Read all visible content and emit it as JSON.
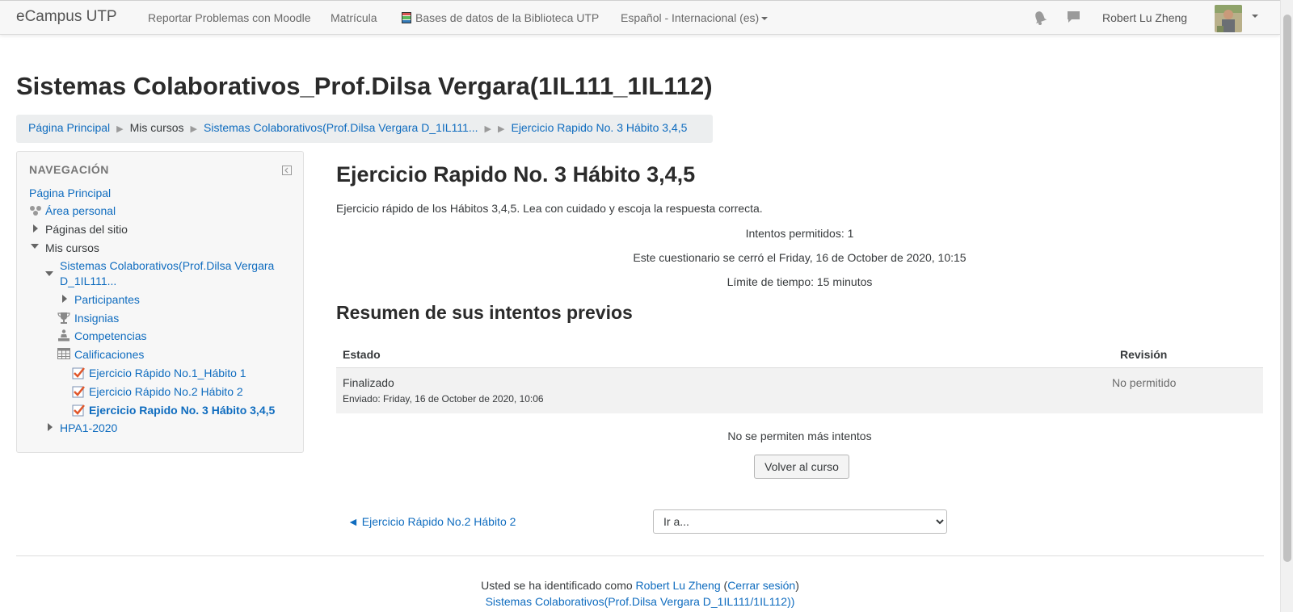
{
  "navbar": {
    "brand": "eCampus UTP",
    "links": [
      "Reportar Problemas con Moodle",
      "Matrícula",
      "Bases de datos de la Biblioteca UTP",
      "Español - Internacional (es)"
    ],
    "icons": [
      "bell-icon",
      "chat-icon"
    ],
    "user_name": "Robert Lu Zheng"
  },
  "page_title": "Sistemas Colaborativos_Prof.Dilsa Vergara(1IL111_1IL112)",
  "breadcrumb": {
    "items": [
      "Página Principal",
      "Mis cursos",
      "Sistemas Colaborativos(Prof.Dilsa Vergara D_1IL111...",
      "Ejercicio Rapido No. 3 Hábito 3,4,5"
    ]
  },
  "navigation": {
    "heading": "NAVEGACIÓN",
    "home": "Página Principal",
    "dashboard": "Área personal",
    "site_pages": "Páginas del sitio",
    "my_courses": "Mis cursos",
    "course_line1": "Sistemas Colaborativos(Prof.Dilsa Vergara",
    "course_line2": "D_1IL111...",
    "participants": "Participantes",
    "badges": "Insignias",
    "competencies": "Competencias",
    "grades": "Calificaciones",
    "quiz1": "Ejercicio Rápido No.1_Hábito 1",
    "quiz2": "Ejercicio Rápido No.2 Hábito 2",
    "quiz3": "Ejercicio Rapido No. 3 Hábito 3,4,5",
    "other_course": "HPA1-2020"
  },
  "main": {
    "title": "Ejercicio Rapido No. 3 Hábito 3,4,5",
    "intro": "Ejercicio rápido de los Hábitos 3,4,5. Lea con cuidado y escoja la respuesta correcta.",
    "attempts_allowed": "Intentos permitidos: 1",
    "closed": "Este cuestionario se cerró el Friday, 16 de October de 2020, 10:15",
    "time_limit": "Límite de tiempo: 15 minutos",
    "summary_title": "Resumen de sus intentos previos",
    "table": {
      "headers": [
        "Estado",
        "Revisión"
      ],
      "rows": [
        {
          "status": "Finalizado",
          "submitted": "Enviado: Friday, 16 de October de 2020, 10:06",
          "review": "No permitido"
        }
      ]
    },
    "no_more_attempts": "No se permiten más intentos",
    "back_button": "Volver al curso",
    "prev_activity": "◄ Ejercicio Rápido No.2 Hábito 2",
    "jump_to": "Ir a..."
  },
  "footer": {
    "logged_in_prefix": "Usted se ha identificado como ",
    "user_name": "Robert Lu Zheng",
    "logout_open": " (",
    "logout": "Cerrar sesión",
    "logout_close": ")",
    "course_link": "Sistemas Colaborativos(Prof.Dilsa Vergara D_1IL111/1IL112))"
  }
}
